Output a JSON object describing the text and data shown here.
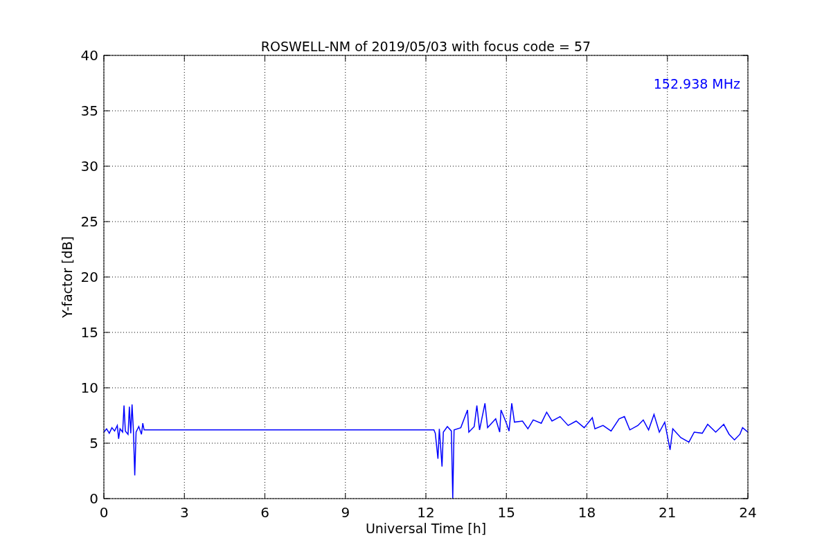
{
  "chart_data": {
    "type": "line",
    "title": "ROSWELL-NM of 2019/05/03 with focus code = 57",
    "xlabel": "Universal Time [h]",
    "ylabel": "Y-factor [dB]",
    "x": [
      0,
      0.1,
      0.2,
      0.3,
      0.4,
      0.5,
      0.55,
      0.6,
      0.7,
      0.75,
      0.8,
      0.9,
      0.95,
      1.0,
      1.05,
      1.1,
      1.15,
      1.2,
      1.3,
      1.4,
      1.45,
      1.5,
      12.3,
      12.35,
      12.45,
      12.5,
      12.6,
      12.65,
      12.8,
      12.95,
      13.0,
      13.05,
      13.3,
      13.55,
      13.6,
      13.8,
      13.9,
      14.0,
      14.2,
      14.3,
      14.6,
      14.75,
      14.8,
      15.0,
      15.1,
      15.2,
      15.3,
      15.6,
      15.8,
      16.0,
      16.3,
      16.5,
      16.7,
      17.0,
      17.3,
      17.6,
      17.9,
      18.2,
      18.3,
      18.6,
      18.9,
      19.2,
      19.4,
      19.6,
      19.9,
      20.1,
      20.3,
      20.5,
      20.7,
      20.9,
      21.1,
      21.2,
      21.5,
      21.8,
      22.0,
      22.3,
      22.5,
      22.8,
      23.1,
      23.3,
      23.5,
      23.7,
      23.8,
      24.0
    ],
    "series": [
      {
        "name": "152.938 MHz",
        "color": "#0000ff",
        "values": [
          6.0,
          6.3,
          5.9,
          6.4,
          6.1,
          6.6,
          5.4,
          6.3,
          6.0,
          8.4,
          6.1,
          5.8,
          8.3,
          5.9,
          8.5,
          6.2,
          2.1,
          6.0,
          6.5,
          5.8,
          6.8,
          6.2,
          6.2,
          5.9,
          3.6,
          6.3,
          2.9,
          6.0,
          6.5,
          6.1,
          0,
          6.2,
          6.4,
          8.0,
          6.0,
          6.5,
          8.4,
          6.2,
          8.6,
          6.4,
          7.2,
          6.0,
          8.0,
          6.8,
          6.1,
          8.6,
          6.9,
          7.0,
          6.3,
          7.1,
          6.8,
          7.8,
          7.0,
          7.4,
          6.6,
          7.0,
          6.4,
          7.3,
          6.3,
          6.6,
          6.1,
          7.2,
          7.4,
          6.2,
          6.6,
          7.1,
          6.2,
          7.6,
          6.0,
          6.9,
          4.4,
          6.3,
          5.5,
          5.1,
          6.0,
          5.9,
          6.7,
          6.0,
          6.7,
          5.8,
          5.3,
          5.8,
          6.4,
          6.0
        ]
      }
    ],
    "xlim": [
      0,
      24
    ],
    "ylim": [
      0,
      40
    ],
    "grid": true,
    "xticks": [
      0,
      3,
      6,
      9,
      12,
      15,
      18,
      21,
      24
    ],
    "yticks": [
      0,
      5,
      10,
      15,
      20,
      25,
      30,
      35,
      40
    ]
  }
}
